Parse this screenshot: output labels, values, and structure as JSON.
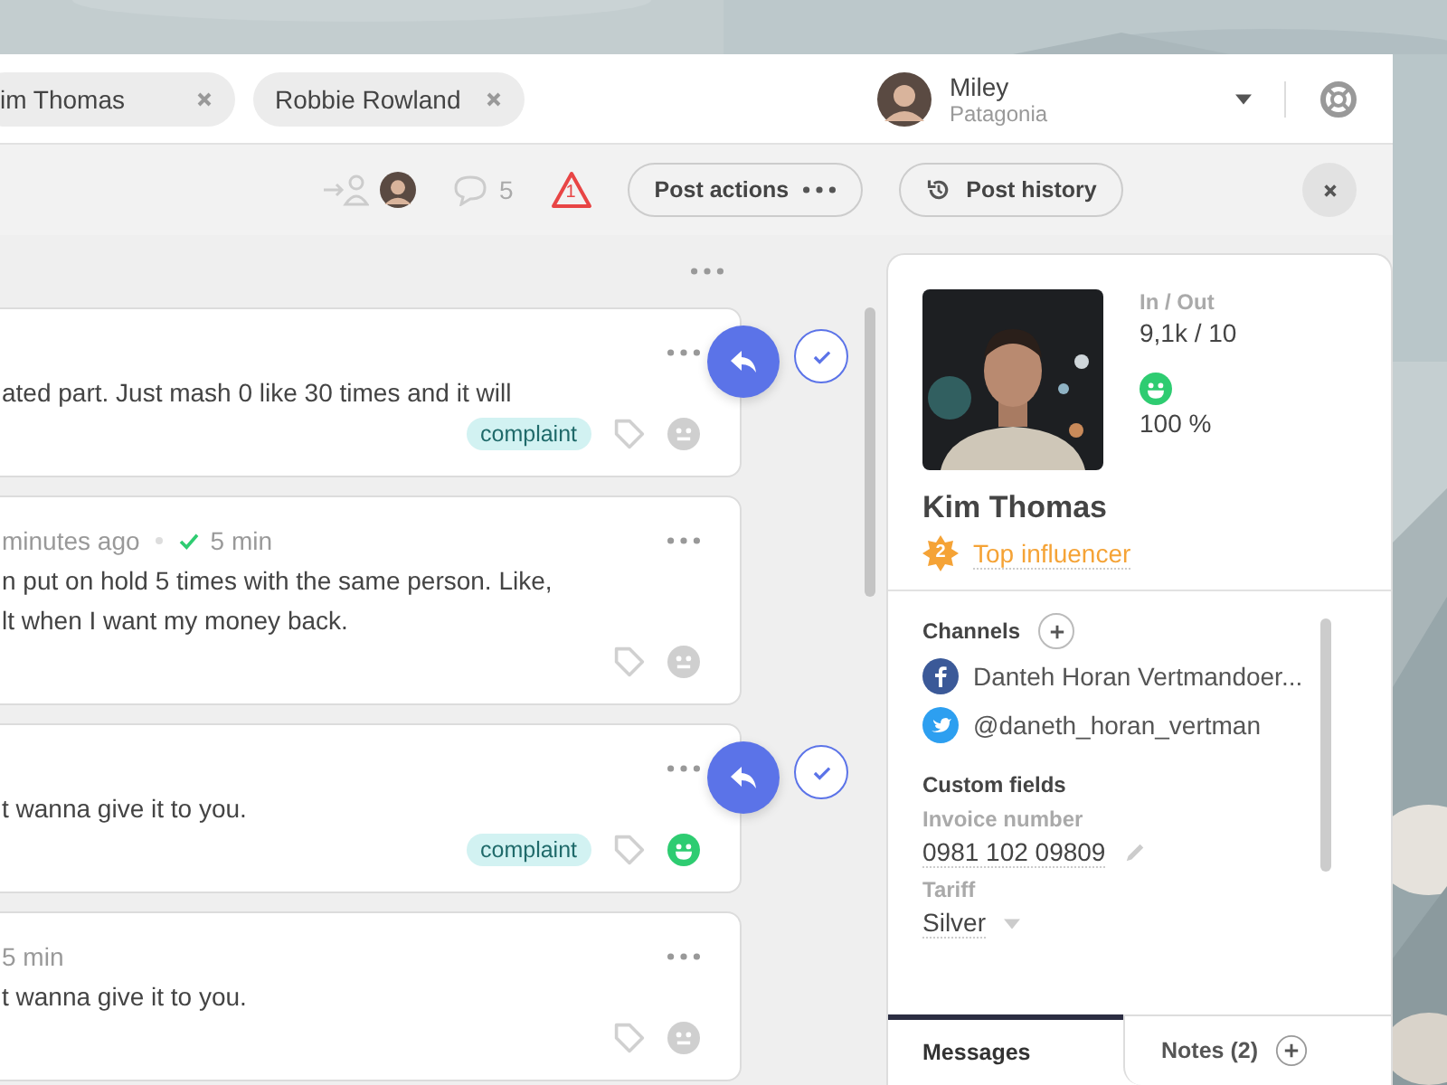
{
  "open_tabs": [
    {
      "label": "im Thomas"
    },
    {
      "label": "Robbie Rowland"
    }
  ],
  "user": {
    "name": "Miley",
    "organization": "Patagonia"
  },
  "toolbar": {
    "comments": "5",
    "alerts": "1",
    "buttons": [
      {
        "label": "Post actions",
        "kind": "more"
      },
      {
        "label": "Post history",
        "kind": "history"
      }
    ]
  },
  "messages": [
    {
      "lines": [
        "ated part. Just mash 0 like 30 times and it will"
      ],
      "tag": "complaint",
      "smiling": false,
      "reply_actions": true
    },
    {
      "time": "minutes ago",
      "response": "5 min",
      "lines": [
        "n put on hold 5 times with the same person. Like,",
        "lt when I want my money back."
      ],
      "smiling": false,
      "reply_actions": false
    },
    {
      "lines": [
        "t wanna give it to you."
      ],
      "tag": "complaint",
      "smiling": true,
      "reply_actions": true
    },
    {
      "time": "5 min",
      "lines": [
        "t wanna give it to you."
      ],
      "smiling": false,
      "reply_actions": false
    }
  ],
  "profile": {
    "name": "Kim Thomas",
    "rank": "2",
    "rank_label": "Top influencer",
    "stats_label": "In / Out",
    "stats": "9,1k / 10",
    "smiling": true,
    "satisfaction": "100 %",
    "channels_title": "Channels",
    "channels": [
      {
        "kind": "facebook",
        "label": "Danteh Horan Vertmandoer..."
      },
      {
        "kind": "twitter",
        "label": "@daneth_horan_vertman"
      }
    ],
    "custom_fields_title": "Custom fields",
    "fields": [
      {
        "label": "Invoice number",
        "value": "0981 102 09809",
        "kind": "editable"
      },
      {
        "label": "Tariff",
        "value": "Silver",
        "kind": "select"
      }
    ],
    "tabs": [
      {
        "label": "Messages",
        "selected": true
      },
      {
        "label": "Notes (2)",
        "selected": false
      }
    ]
  }
}
